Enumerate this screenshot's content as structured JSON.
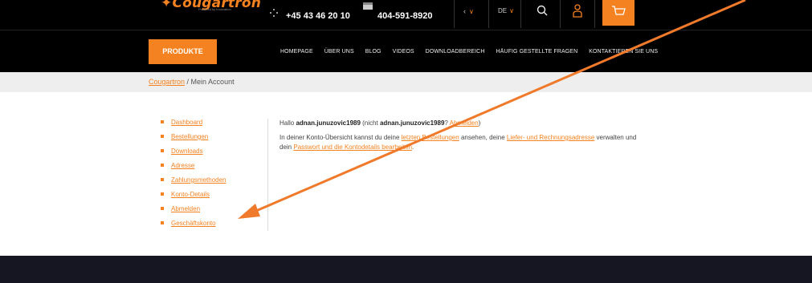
{
  "header": {
    "logo_text": "Cougartron",
    "logo_tagline": "Powered by Innovation",
    "phone1": "+45 43 46 20 10",
    "phone2": "404-591-8920",
    "lang": "DE"
  },
  "nav": {
    "produkte": "PRODUKTE",
    "links": [
      "HOMEPAGE",
      "ÜBER UNS",
      "BLOG",
      "VIDEOS",
      "DOWNLOADBEREICH",
      "HÄUFIG GESTELLTE FRAGEN",
      "KONTAKTIEREN SIE UNS"
    ]
  },
  "breadcrumb": {
    "home": "Cougartron",
    "separator": " / ",
    "current": "Mein Account"
  },
  "sidebar": {
    "items": [
      "Dashboard",
      "Bestellungen",
      "Downloads",
      "Adresse",
      "Zahlungsmethoden",
      "Konto-Details",
      "Abmelden",
      "Geschäftskonto"
    ]
  },
  "content": {
    "hello_prefix": "Hallo ",
    "username": "adnan.junuzovic1989",
    "paren_open": " (nicht ",
    "username2": "adnan.junuzovic1989",
    "question": "? ",
    "logout_link": "Abmelden",
    "paren_close": ")",
    "p2_a": "In deiner Konto-Übersicht kannst du deine ",
    "p2_link1": "letzten Bestellungen",
    "p2_b": " ansehen, deine ",
    "p2_link2": "Liefer- und Rechnungsadresse",
    "p2_c": " verwalten und dein ",
    "p2_link3": "Passwort und die Kontodetails bearbeiten",
    "p2_d": "."
  },
  "colors": {
    "accent": "#f58220",
    "topbar": "#000000",
    "footer": "#161622"
  }
}
